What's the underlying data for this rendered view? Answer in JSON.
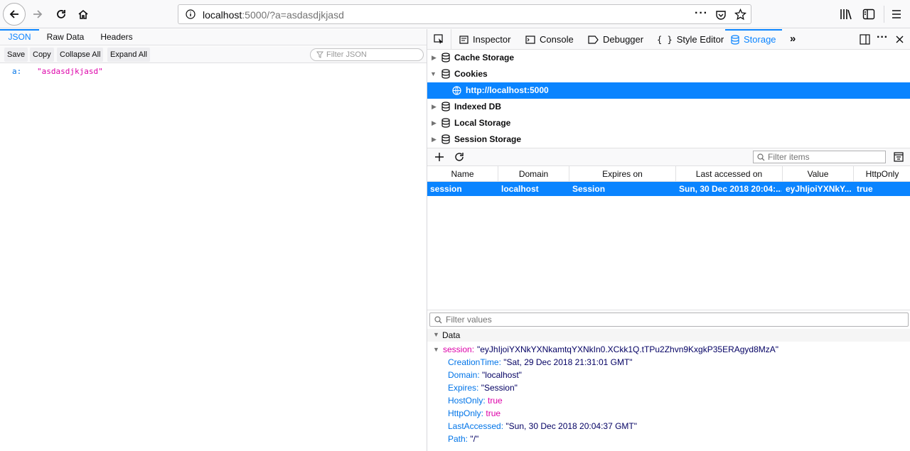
{
  "url": {
    "host": "localhost",
    "path": ":5000/?a=asdasdjkjasd"
  },
  "json_viewer": {
    "tabs": [
      "JSON",
      "Raw Data",
      "Headers"
    ],
    "toolbar": [
      "Save",
      "Copy",
      "Collapse All",
      "Expand All"
    ],
    "filter_placeholder": "Filter JSON",
    "entry": {
      "key": "a:",
      "value": "\"asdasdjkjasd\""
    }
  },
  "devtools": {
    "tabs": [
      "Inspector",
      "Console",
      "Debugger",
      "Style Editor",
      "Storage"
    ],
    "selected_tab": "Storage",
    "tree": [
      "Cache Storage",
      "Cookies",
      "http://localhost:5000",
      "Indexed DB",
      "Local Storage",
      "Session Storage"
    ],
    "filter_items_placeholder": "Filter items",
    "columns": [
      "Name",
      "Domain",
      "Expires on",
      "Last accessed on",
      "Value",
      "HttpOnly"
    ],
    "row": {
      "name": "session",
      "domain": "localhost",
      "expires": "Session",
      "last_accessed": "Sun, 30 Dec 2018 20:04:...",
      "value": "eyJhIjoiYXNkY...",
      "httponly": "true"
    },
    "filter_values_placeholder": "Filter values",
    "data_label": "Data",
    "session_key": "session:",
    "session_value": "\"eyJhIjoiYXNkYXNkamtqYXNkIn0.XCkk1Q.tTPu2Zhvn9KxgkP35ERAgyd8MzA\"",
    "props": [
      {
        "key": "CreationTime:",
        "value": "\"Sat, 29 Dec 2018 21:31:01 GMT\""
      },
      {
        "key": "Domain:",
        "value": "\"localhost\""
      },
      {
        "key": "Expires:",
        "value": "\"Session\""
      },
      {
        "key": "HostOnly:",
        "value": "true"
      },
      {
        "key": "HttpOnly:",
        "value": "true"
      },
      {
        "key": "LastAccessed:",
        "value": "\"Sun, 30 Dec 2018 20:04:37 GMT\""
      },
      {
        "key": "Path:",
        "value": "\"/\""
      }
    ]
  }
}
